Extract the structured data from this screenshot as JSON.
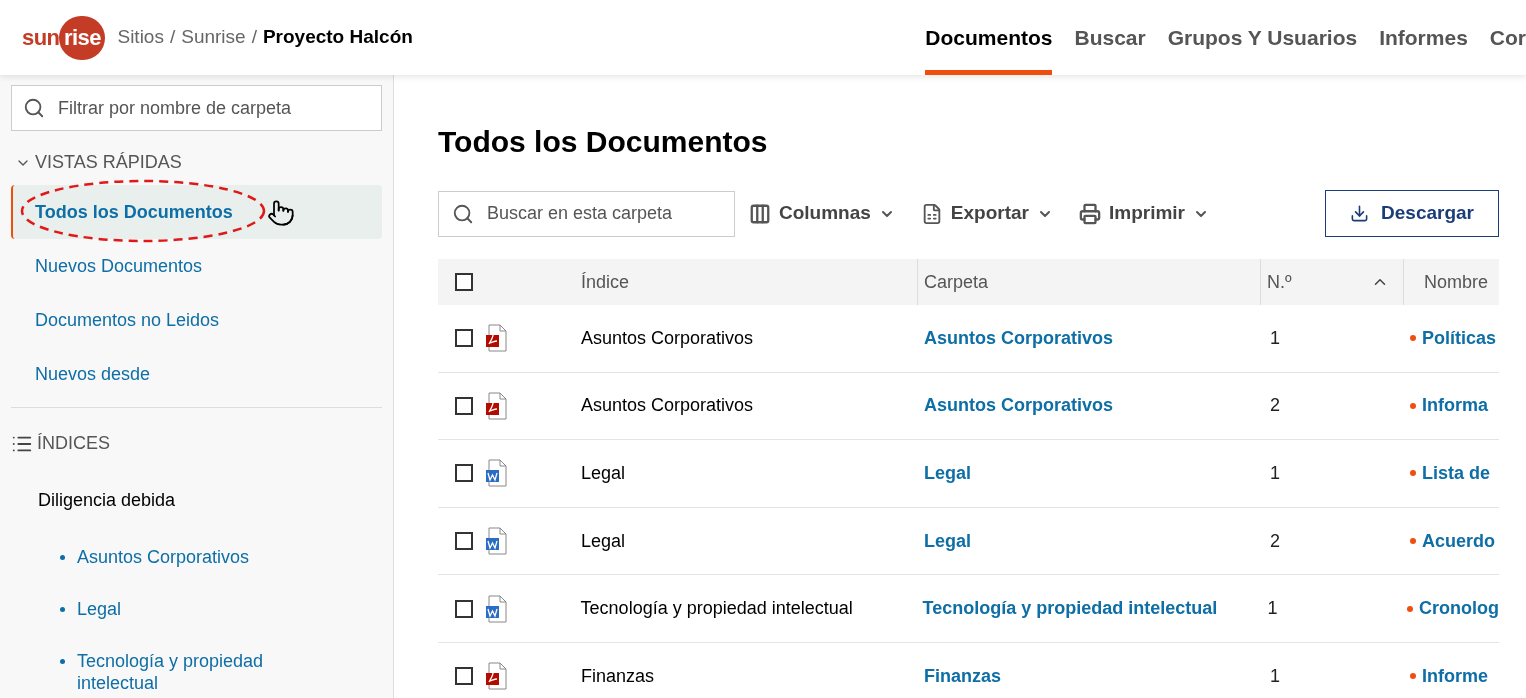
{
  "header": {
    "logo": "sunrise",
    "breadcrumb": [
      "Sitios",
      "Sunrise"
    ],
    "breadcrumb_current": "Proyecto Halcón",
    "separator": "/",
    "nav": [
      {
        "label": "Documentos",
        "selected": true
      },
      {
        "label": "Buscar",
        "selected": false
      },
      {
        "label": "Grupos Y Usuarios",
        "selected": false
      },
      {
        "label": "Informes",
        "selected": false
      },
      {
        "label": "Cor",
        "selected": false
      }
    ]
  },
  "sidebar": {
    "filter": {
      "placeholder": "Filtrar por nombre de carpeta"
    },
    "quick_views": {
      "title": "VISTAS RÁPIDAS",
      "expanded": true,
      "items": [
        {
          "label": "Todos los Documentos",
          "selected": true
        },
        {
          "label": "Nuevos Documentos",
          "selected": false
        },
        {
          "label": "Documentos no Leidos",
          "selected": false
        },
        {
          "label": "Nuevos desde",
          "selected": false
        }
      ]
    },
    "indexes": {
      "title": "ÍNDICES",
      "items": [
        {
          "label": "Diligencia debida",
          "children": [
            {
              "label": "Asuntos Corporativos"
            },
            {
              "label": "Legal"
            },
            {
              "label": "Tecnología y propiedad intelectual"
            }
          ]
        }
      ]
    }
  },
  "main": {
    "title": "Todos los Documentos",
    "search": {
      "placeholder": "Buscar en esta carpeta"
    },
    "toolbar": [
      {
        "kind": "columns",
        "label": "Columnas"
      },
      {
        "kind": "export",
        "label": "Exportar"
      },
      {
        "kind": "print",
        "label": "Imprimir"
      }
    ],
    "download": "Descargar",
    "table": {
      "columns": [
        "Índice",
        "Carpeta",
        "N.º",
        "Nombre"
      ],
      "select_all_checked": false,
      "rows": [
        {
          "checked": false,
          "kind": "pdf",
          "index": "Asuntos Corporativos",
          "folder": "Asuntos Corporativos",
          "number": "1",
          "name": "Políticas"
        },
        {
          "checked": false,
          "kind": "pdf",
          "index": "Asuntos Corporativos",
          "folder": "Asuntos Corporativos",
          "number": "2",
          "name": "Informa"
        },
        {
          "checked": false,
          "kind": "word",
          "index": "Legal",
          "folder": "Legal",
          "number": "1",
          "name": "Lista de"
        },
        {
          "checked": false,
          "kind": "word",
          "index": "Legal",
          "folder": "Legal",
          "number": "2",
          "name": "Acuerdo"
        },
        {
          "checked": false,
          "kind": "word",
          "index": "Tecnología y propiedad intelectual",
          "folder": "Tecnología y propiedad intelectual",
          "number": "1",
          "name": "Cronolog"
        },
        {
          "checked": false,
          "kind": "pdf",
          "index": "Finanzas",
          "folder": "Finanzas",
          "number": "1",
          "name": "Informe"
        }
      ]
    }
  }
}
